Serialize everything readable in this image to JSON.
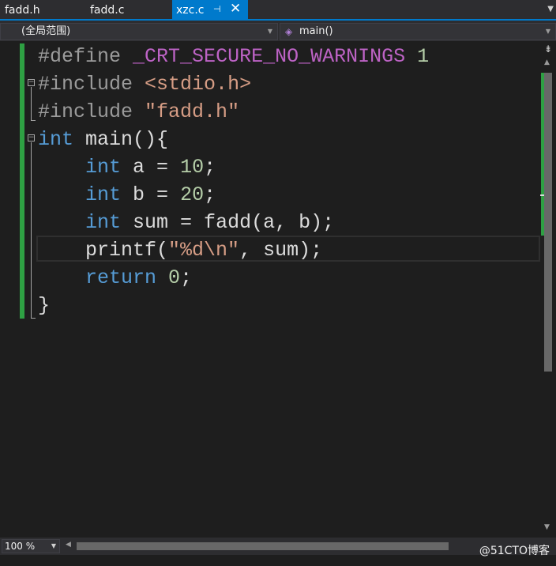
{
  "tabs": [
    {
      "label": "fadd.h",
      "active": false
    },
    {
      "label": "fadd.c",
      "active": false
    },
    {
      "label": "xzc.c",
      "active": true
    }
  ],
  "tab_icons": {
    "pin": "pin-icon",
    "close": "close-icon",
    "menu": "dropdown-arrow-icon"
  },
  "navigation": {
    "scope": "(全局范围)",
    "function": "main()"
  },
  "code_lines": [
    "#define _CRT_SECURE_NO_WARNINGS 1",
    "#include <stdio.h>",
    "#include \"fadd.h\"",
    "int main(){",
    "    int a = 10;",
    "    int b = 20;",
    "    int sum = fadd(a, b);",
    "    printf(\"%d\\n\", sum);",
    "    return 0;",
    "}"
  ],
  "code_tokens": {
    "l1": {
      "kw": "#define",
      "macro": "_CRT_SECURE_NO_WARNINGS",
      "num": "1"
    },
    "l2": {
      "kw": "#include",
      "str": "<stdio.h>"
    },
    "l3": {
      "kw": "#include",
      "str": "\"fadd.h\""
    },
    "l4": {
      "kw": "int",
      "rest": "main(){"
    },
    "l5": {
      "kw": "int",
      "rest": "a = ",
      "num": "10",
      "end": ";"
    },
    "l6": {
      "kw": "int",
      "rest": "b = ",
      "num": "20",
      "end": ";"
    },
    "l7": {
      "kw": "int",
      "rest": "sum = fadd(a, b);"
    },
    "l8": {
      "fn": "printf(",
      "str": "\"%d\\n\"",
      "rest": ", sum);"
    },
    "l9": {
      "kw": "return",
      "num": "0",
      "end": ";"
    },
    "l10": {
      "rest": "}"
    }
  },
  "status": {
    "zoom": "100 %"
  },
  "watermark": "@51CTO博客",
  "colors": {
    "keyword": "#569cd6",
    "preprocessor": "#9b9b9b",
    "macro": "#bd63c5",
    "number": "#b5cea8",
    "string": "#d69d85",
    "accent": "#007acc",
    "change_bar": "#2ea043"
  }
}
